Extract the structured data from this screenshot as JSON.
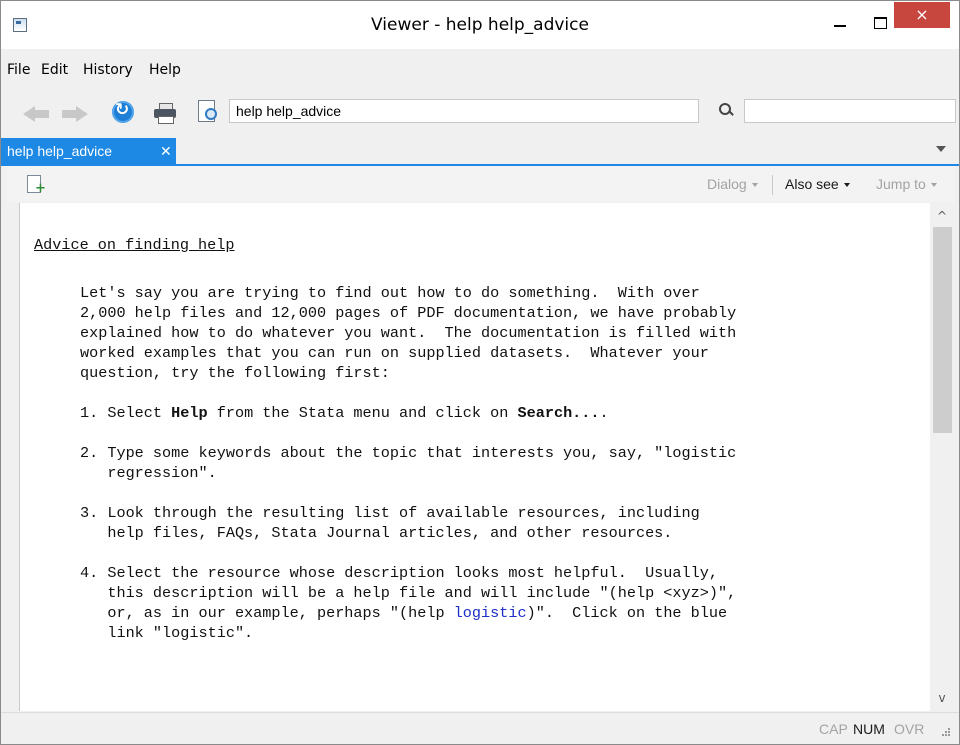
{
  "window": {
    "title": "Viewer - help help_advice",
    "close_label": "×"
  },
  "menu": {
    "file": "File",
    "edit": "Edit",
    "history": "History",
    "help": "Help"
  },
  "toolbar": {
    "command_value": "help help_advice",
    "find_value": ""
  },
  "tab": {
    "label": "help help_advice",
    "close": "✕"
  },
  "viewer_buttons": {
    "dialog": "Dialog",
    "also_see": "Also see",
    "jump_to": "Jump to"
  },
  "content": {
    "heading": "Advice on finding help",
    "intro": [
      "Let's say you are trying to find out how to do something.  With over",
      "2,000 help files and 12,000 pages of PDF documentation, we have probably",
      "explained how to do whatever you want.  The documentation is filled with",
      "worked examples that you can run on supplied datasets.  Whatever your",
      "question, try the following first:"
    ],
    "step1": {
      "a": "1. Select ",
      "help": "Help",
      "b": " from the Stata menu and click on ",
      "search": "Search...",
      "c": "."
    },
    "step2": [
      "2. Type some keywords about the topic that interests you, say, \"logistic",
      "   regression\"."
    ],
    "step3": [
      "3. Look through the resulting list of available resources, including",
      "   help files, FAQs, Stata Journal articles, and other resources."
    ],
    "step4": {
      "line1": "4. Select the resource whose description looks most helpful.  Usually,",
      "line2": "   this description will be a help file and will include \"(help <xyz>)\",",
      "line3_a": "   or, as in our example, perhaps \"(help ",
      "line3_link": "logistic",
      "line3_b": ")\".  Click on the blue",
      "line4": "   link \"logistic\"."
    }
  },
  "status": {
    "cap": "CAP",
    "num": "NUM",
    "ovr": "OVR"
  }
}
